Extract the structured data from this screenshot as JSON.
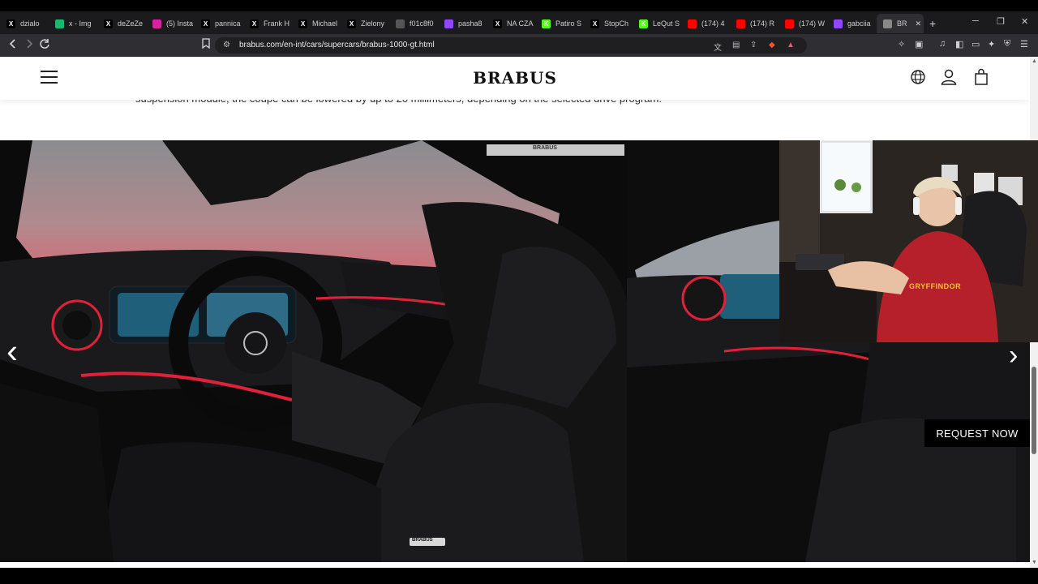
{
  "browser": {
    "tabs": [
      {
        "label": "dzialo",
        "icon": "x-icon",
        "color": "#000000"
      },
      {
        "label": "x - Img",
        "icon": "imgur-icon",
        "color": "#1bb76e"
      },
      {
        "label": "deZeZe",
        "icon": "x-icon",
        "color": "#000000"
      },
      {
        "label": "(5) Insta",
        "icon": "instagram-icon",
        "color": "#d6249f"
      },
      {
        "label": "pannica",
        "icon": "x-icon",
        "color": "#000000"
      },
      {
        "label": "Frank H",
        "icon": "x-icon",
        "color": "#000000"
      },
      {
        "label": "Michael",
        "icon": "x-icon",
        "color": "#000000"
      },
      {
        "label": "Zielony",
        "icon": "x-icon",
        "color": "#000000"
      },
      {
        "label": "f01c8f0",
        "icon": "github-icon",
        "color": "#555555"
      },
      {
        "label": "pasha8",
        "icon": "twitch-icon",
        "color": "#9146ff"
      },
      {
        "label": "NA CZA",
        "icon": "x-icon",
        "color": "#000000"
      },
      {
        "label": "Patiro S",
        "icon": "kick-icon",
        "color": "#53fc18"
      },
      {
        "label": "StopCh",
        "icon": "x-icon",
        "color": "#000000"
      },
      {
        "label": "LeQut S",
        "icon": "kick-icon",
        "color": "#53fc18"
      },
      {
        "label": "(174) 4",
        "icon": "youtube-icon",
        "color": "#ff0000"
      },
      {
        "label": "(174) R",
        "icon": "youtube-icon",
        "color": "#ff0000"
      },
      {
        "label": "(174) W",
        "icon": "youtube-icon",
        "color": "#ff0000"
      },
      {
        "label": "gabciia",
        "icon": "twitch-icon",
        "color": "#9146ff"
      },
      {
        "label": "BR",
        "icon": "globe-icon",
        "color": "#888888"
      }
    ],
    "url": "brabus.com/en-int/cars/supercars/brabus-1000-gt.html",
    "new_tab": "+",
    "min": "─",
    "max": "❐",
    "close": "✕",
    "tab_close": "✕"
  },
  "page": {
    "logo": "BRABUS",
    "body_text": "suspension module, the coupe can be lowered by up to 20 millimeters, depending on the selected drive program.",
    "gallery": {
      "prev": "‹",
      "next": "›",
      "badge": "BRABUS",
      "seat_badge": "BRABUS"
    },
    "request_button": "REQUEST NOW"
  },
  "webcam": {
    "shirt_text": "GRYFFINDOR"
  },
  "colors": {
    "accent_red": "#e2203a",
    "page_bg": "#ffffff",
    "browser_bg": "#2f2f33"
  }
}
